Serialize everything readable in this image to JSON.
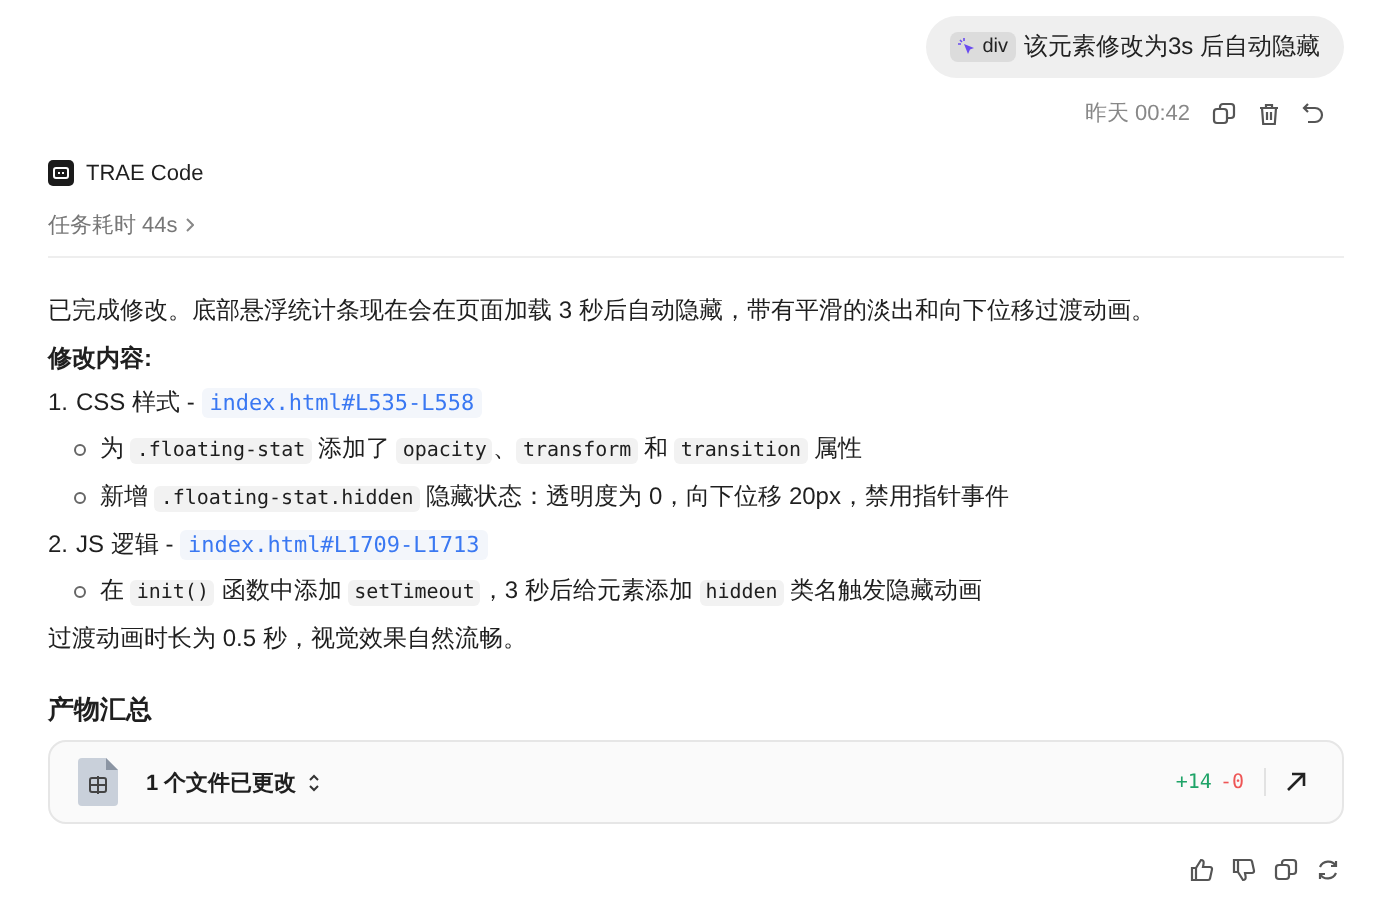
{
  "user_message": {
    "chip": "div",
    "text": "该元素修改为3s 后自动隐藏",
    "time": "昨天 00:42"
  },
  "agent": {
    "name": "TRAE Code",
    "duration": "任务耗时 44s"
  },
  "summary": "已完成修改。底部悬浮统计条现在会在页面加载 3 秒后自动隐藏，带有平滑的淡出和向下位移过渡动画。",
  "heading": "修改内容:",
  "changes": [
    {
      "number": "1.",
      "parts": [
        {
          "kind": "text",
          "text": "CSS 样式 - "
        },
        {
          "kind": "link",
          "text": "index.html#L535-L558"
        }
      ],
      "children": [
        {
          "parts": [
            {
              "kind": "text",
              "text": "为 "
            },
            {
              "kind": "code",
              "text": ".floating-stat"
            },
            {
              "kind": "text",
              "text": " 添加了 "
            },
            {
              "kind": "code",
              "text": "opacity"
            },
            {
              "kind": "text",
              "text": "、"
            },
            {
              "kind": "code",
              "text": "transform"
            },
            {
              "kind": "text",
              "text": " 和 "
            },
            {
              "kind": "code",
              "text": "transition"
            },
            {
              "kind": "text",
              "text": " 属性"
            }
          ]
        },
        {
          "parts": [
            {
              "kind": "text",
              "text": "新增 "
            },
            {
              "kind": "code",
              "text": ".floating-stat.hidden"
            },
            {
              "kind": "text",
              "text": " 隐藏状态：透明度为 0，向下位移 20px，禁用指针事件"
            }
          ]
        }
      ]
    },
    {
      "number": "2.",
      "parts": [
        {
          "kind": "text",
          "text": "JS 逻辑 - "
        },
        {
          "kind": "link",
          "text": "index.html#L1709-L1713"
        }
      ],
      "children": [
        {
          "parts": [
            {
              "kind": "text",
              "text": "在 "
            },
            {
              "kind": "code",
              "text": "init()"
            },
            {
              "kind": "text",
              "text": " 函数中添加 "
            },
            {
              "kind": "code",
              "text": "setTimeout"
            },
            {
              "kind": "text",
              "text": "，3 秒后给元素添加 "
            },
            {
              "kind": "code",
              "text": "hidden"
            },
            {
              "kind": "text",
              "text": " 类名触发隐藏动画"
            }
          ]
        }
      ]
    }
  ],
  "closing": "过渡动画时长为 0.5 秒，视觉效果自然流畅。",
  "artifacts": {
    "title": "产物汇总",
    "files_changed": "1 个文件已更改",
    "additions": "+14",
    "deletions": "-0"
  }
}
